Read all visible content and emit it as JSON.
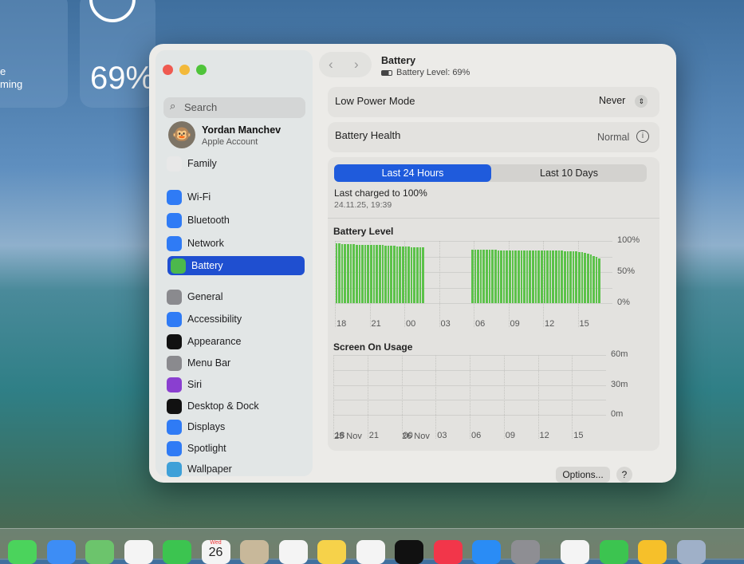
{
  "desktop": {
    "widget_percent": "69%",
    "widget_text_1": "e",
    "widget_text_2": "ming"
  },
  "window": {
    "title": "Battery",
    "subtitle": "Battery Level: 69%",
    "sidebar": {
      "search_placeholder": "Search",
      "account": {
        "name": "Yordan Manchev",
        "sub": "Apple Account"
      },
      "items": [
        {
          "label": "Family",
          "icon": "family-icon",
          "color": "#e8e8e8"
        },
        {
          "label": "Wi-Fi",
          "icon": "wifi-icon",
          "color": "#2f7bf5"
        },
        {
          "label": "Bluetooth",
          "icon": "bluetooth-icon",
          "color": "#2f7bf5"
        },
        {
          "label": "Network",
          "icon": "globe-icon",
          "color": "#2f7bf5"
        },
        {
          "label": "Battery",
          "icon": "battery-icon",
          "color": "#4cb84c",
          "selected": true
        },
        {
          "label": "General",
          "icon": "gear-icon",
          "color": "#8a8a8e"
        },
        {
          "label": "Accessibility",
          "icon": "accessibility-icon",
          "color": "#2f7bf5"
        },
        {
          "label": "Appearance",
          "icon": "appearance-icon",
          "color": "#111111"
        },
        {
          "label": "Menu Bar",
          "icon": "menubar-icon",
          "color": "#8a8a8e"
        },
        {
          "label": "Siri",
          "icon": "siri-icon",
          "color": "#8a3fd0"
        },
        {
          "label": "Desktop & Dock",
          "icon": "dock-icon",
          "color": "#111111"
        },
        {
          "label": "Displays",
          "icon": "sun-icon",
          "color": "#2f7bf5"
        },
        {
          "label": "Spotlight",
          "icon": "magnifier-icon",
          "color": "#2f7bf5"
        },
        {
          "label": "Wallpaper",
          "icon": "flower-icon",
          "color": "#3ea0d8"
        }
      ]
    },
    "low_power": {
      "label": "Low Power Mode",
      "value": "Never"
    },
    "health": {
      "label": "Battery Health",
      "value": "Normal"
    },
    "tabs": [
      {
        "label": "Last 24 Hours",
        "active": true
      },
      {
        "label": "Last 10 Days",
        "active": false
      }
    ],
    "last_charged": {
      "label": "Last charged to 100%",
      "time": "24.11.25, 19:39"
    },
    "options_label": "Options...",
    "help_label": "?"
  },
  "chart_data": [
    {
      "type": "bar",
      "title": "Battery Level",
      "ylabel": "",
      "ylim": [
        0,
        100
      ],
      "y_ticks": [
        "100%",
        "50%",
        "0%"
      ],
      "x_ticks": [
        "18",
        "21",
        "00",
        "03",
        "06",
        "09",
        "12",
        "15"
      ],
      "interval_minutes": 15,
      "start_hour": 18,
      "color": "#5cc24a",
      "values": [
        96,
        96,
        95,
        95,
        95,
        95,
        95,
        94,
        94,
        94,
        94,
        94,
        93,
        93,
        93,
        93,
        93,
        92,
        92,
        92,
        92,
        91,
        91,
        91,
        91,
        91,
        90,
        90,
        90,
        90,
        90,
        null,
        null,
        null,
        null,
        null,
        null,
        null,
        null,
        null,
        null,
        null,
        null,
        null,
        null,
        null,
        null,
        86,
        86,
        86,
        86,
        86,
        86,
        86,
        86,
        86,
        85,
        85,
        85,
        85,
        85,
        85,
        85,
        85,
        85,
        85,
        85,
        84,
        84,
        84,
        84,
        84,
        84,
        84,
        84,
        84,
        84,
        84,
        84,
        83,
        83,
        83,
        83,
        83,
        82,
        82,
        81,
        80,
        78,
        76,
        74,
        72
      ]
    },
    {
      "type": "bar",
      "title": "Screen On Usage",
      "ylim": [
        0,
        60
      ],
      "y_ticks": [
        "60m",
        "30m",
        "0m"
      ],
      "x_ticks": [
        "18",
        "21",
        "00",
        "03",
        "06",
        "09",
        "12",
        "15"
      ],
      "date_labels": [
        "25 Nov",
        "26 Nov"
      ],
      "values": []
    }
  ],
  "dock": {
    "calendar_day": "Wed",
    "calendar_date": "26",
    "apps": [
      {
        "name": "messages",
        "color": "#4bd35c"
      },
      {
        "name": "mail",
        "color": "#3d8df5"
      },
      {
        "name": "maps",
        "color": "#6cc46c"
      },
      {
        "name": "photos",
        "color": "#f4f4f4"
      },
      {
        "name": "facetime",
        "color": "#3cc450"
      },
      {
        "name": "calendar",
        "color": "#f4f4f4"
      },
      {
        "name": "contacts",
        "color": "#c8b89a"
      },
      {
        "name": "reminders",
        "color": "#f4f4f4"
      },
      {
        "name": "notes",
        "color": "#f6d24a"
      },
      {
        "name": "freeform",
        "color": "#f4f4f4"
      },
      {
        "name": "tv",
        "color": "#111111"
      },
      {
        "name": "music",
        "color": "#f2364a"
      },
      {
        "name": "app-store",
        "color": "#2a8cf5"
      },
      {
        "name": "system-settings",
        "color": "#8e8e93"
      },
      {
        "name": "chrome",
        "color": "#f4f4f4"
      },
      {
        "name": "numbers",
        "color": "#3cc450"
      },
      {
        "name": "keynote",
        "color": "#f6c02a"
      },
      {
        "name": "downloads",
        "color": "#9fb0c8"
      }
    ]
  }
}
